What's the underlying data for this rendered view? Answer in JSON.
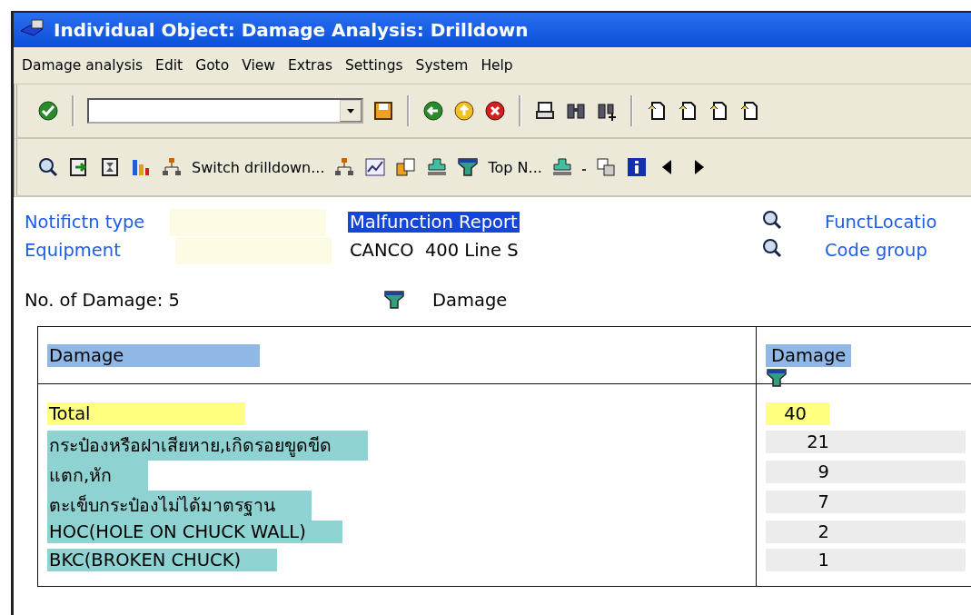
{
  "window": {
    "title": "Individual Object: Damage Analysis: Drilldown"
  },
  "menu": [
    "Damage analysis",
    "Edit",
    "Goto",
    "View",
    "Extras",
    "Settings",
    "System",
    "Help"
  ],
  "toolbar2": {
    "drilldown_label": "Switch drilldown...",
    "topn_label": "Top N..."
  },
  "header_fields": [
    {
      "label": "Notifictn type",
      "value": "Malfunction Report",
      "selected": true,
      "link": "FunctLocatio"
    },
    {
      "label": "Equipment",
      "value": "CANCO  400 Line S",
      "selected": false,
      "link": "Code group"
    }
  ],
  "summary": {
    "count_label": "No. of Damage: 5",
    "characteristic": "Damage"
  },
  "table": {
    "columns": [
      "Damage",
      "Damage"
    ],
    "rows": [
      {
        "label": "Total",
        "value": "40",
        "kind": "total"
      },
      {
        "label": "กระป๋องหรือฝาเสียหาย,เกิดรอยขูดขีด",
        "value": "21",
        "kind": "item"
      },
      {
        "label": "แตก,หัก",
        "value": "9",
        "kind": "item"
      },
      {
        "label": "ตะเข็บกระป๋องไม่ได้มาตรฐาน",
        "value": "7",
        "kind": "item"
      },
      {
        "label": "HOC(HOLE ON CHUCK WALL)",
        "value": "2",
        "kind": "item"
      },
      {
        "label": "BKC(BROKEN CHUCK)",
        "value": "1",
        "kind": "item"
      }
    ]
  }
}
